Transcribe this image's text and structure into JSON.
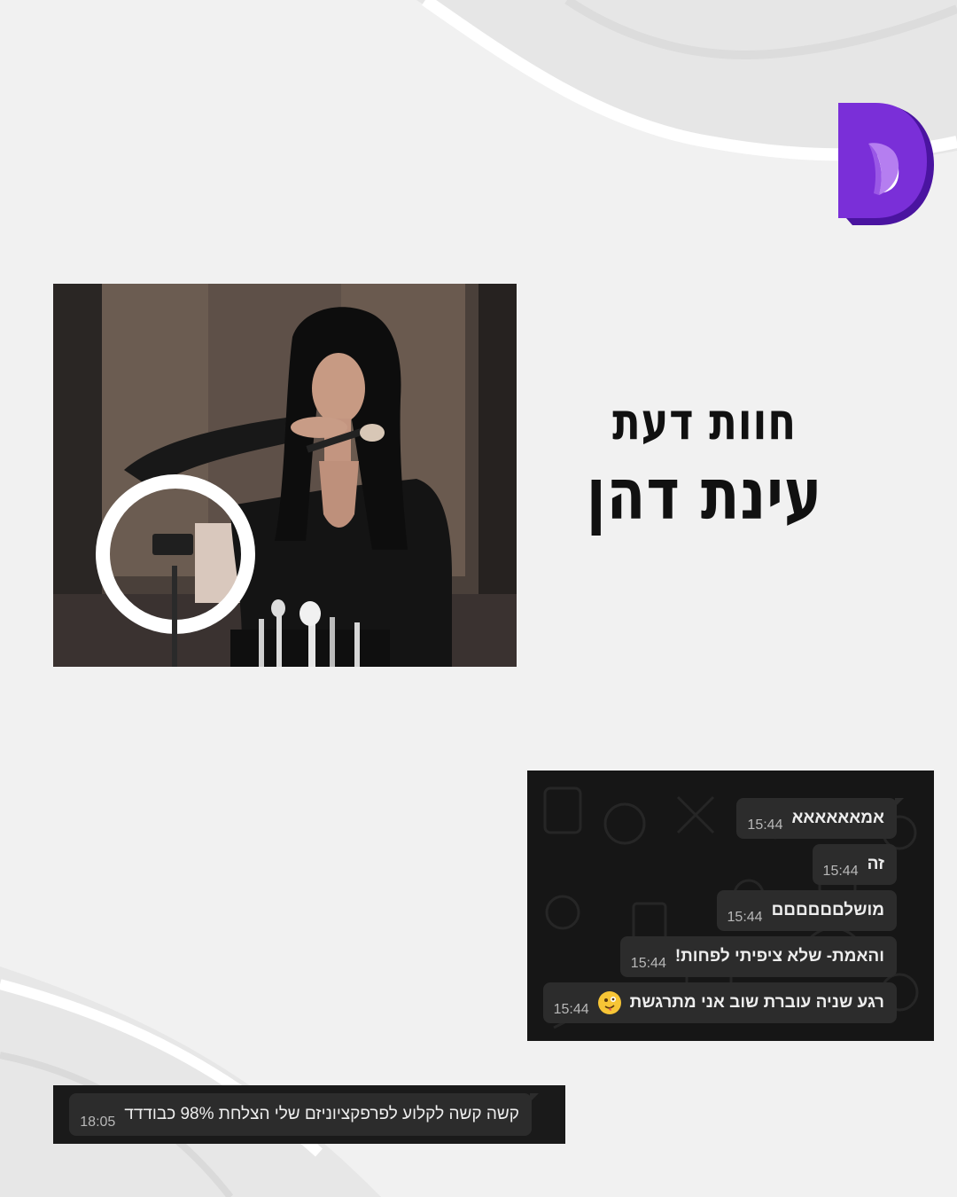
{
  "brand": {
    "logo_icon": "purple-d-logo-icon",
    "accent": "#6a22c9"
  },
  "title": {
    "line1": "חוות דעת",
    "line2": "עינת דהן"
  },
  "photo": {
    "icon": "makeup-artist-photo"
  },
  "chat": {
    "messages": [
      {
        "text": "אמאאאאאא",
        "time": "15:44"
      },
      {
        "text": "זה",
        "time": "15:44"
      },
      {
        "text": "מושלםםםםםם",
        "time": "15:44"
      },
      {
        "text": "והאמת- שלא ציפיתי לפחות!",
        "time": "15:44"
      },
      {
        "text": "רגע שניה עוברת שוב אני מתרגשת",
        "time": "15:44",
        "emoji": "zany-face-icon"
      }
    ]
  },
  "chat2": {
    "text": "קשה קשה לקלוע לפרפקציוניזם שלי הצלחת 98% כבודדד",
    "time": "18:05"
  }
}
